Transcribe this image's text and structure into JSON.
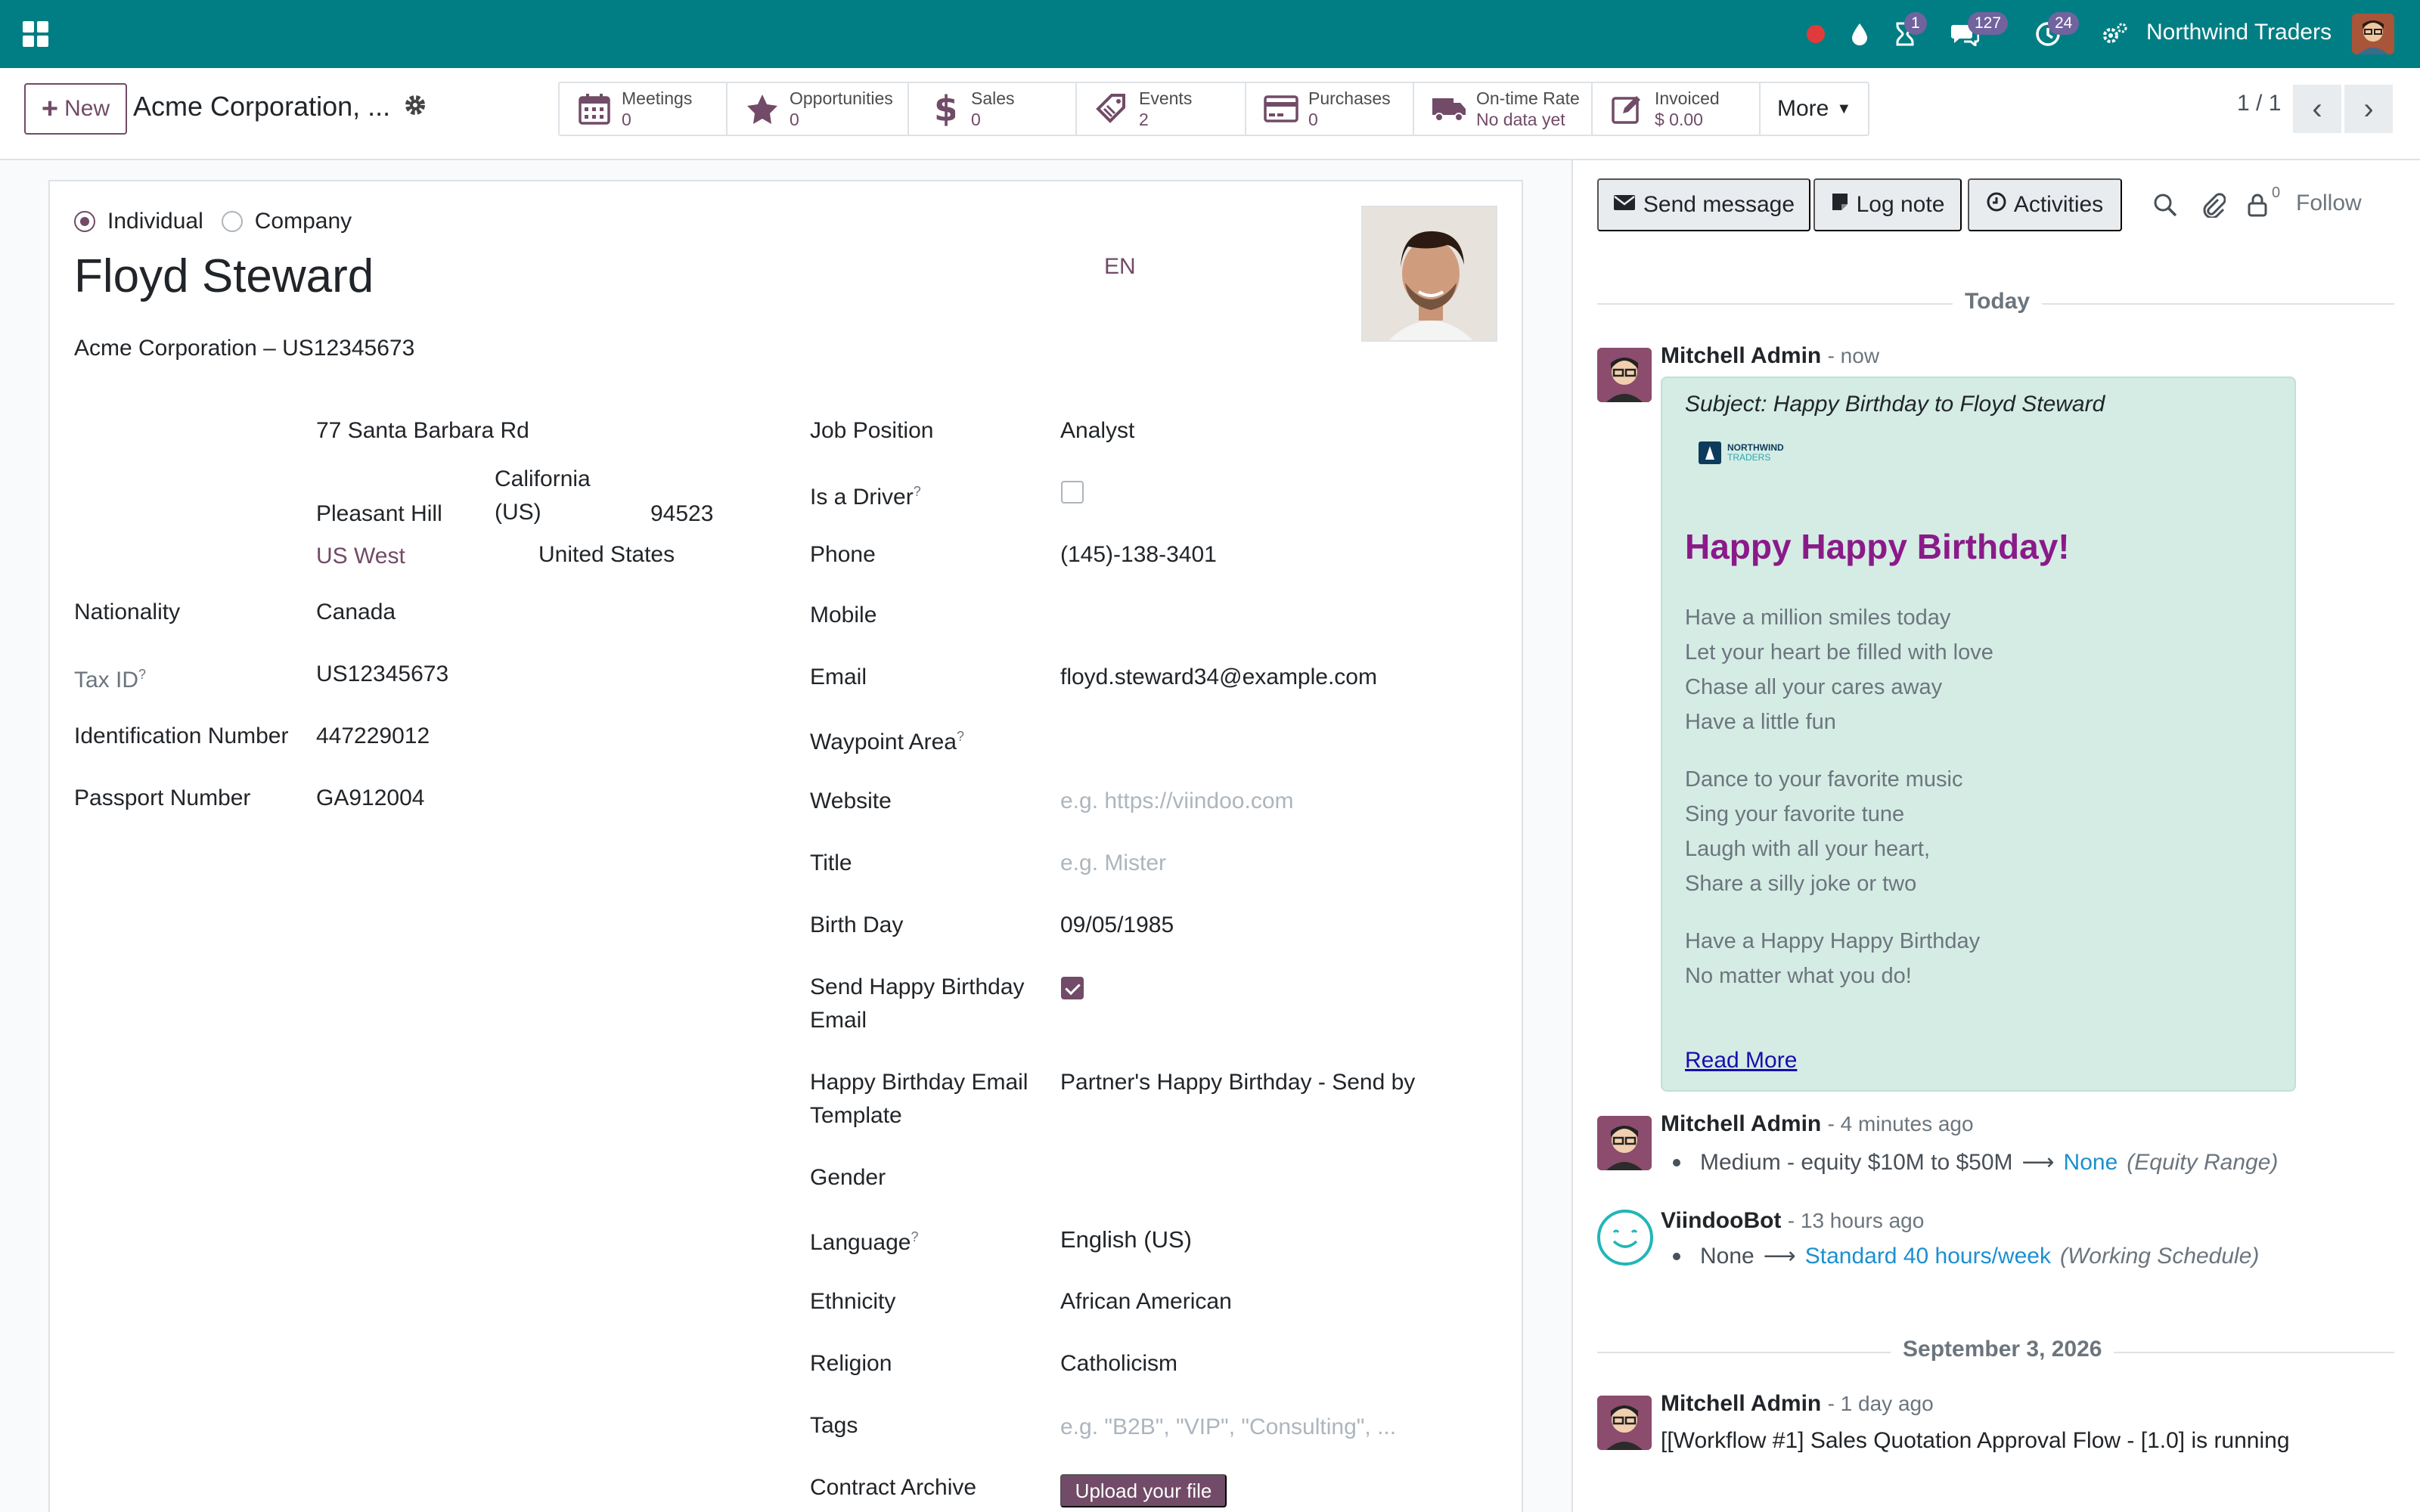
{
  "topbar": {
    "company": "Northwind Traders",
    "badges": {
      "activities": "1",
      "messages": "127",
      "clock": "24"
    }
  },
  "control_panel": {
    "new_label": "New",
    "record_title": "Acme Corporation, ...",
    "smart_buttons": [
      {
        "label": "Meetings",
        "value": "0",
        "icon": "calendar-icon"
      },
      {
        "label": "Opportunities",
        "value": "0",
        "icon": "star-icon"
      },
      {
        "label": "Sales",
        "value": "0",
        "icon": "dollar-icon"
      },
      {
        "label": "Events",
        "value": "2",
        "icon": "ticket-icon"
      },
      {
        "label": "Purchases",
        "value": "0",
        "icon": "credit-card-icon"
      },
      {
        "label": "On-time Rate",
        "value": "No data yet",
        "icon": "truck-icon"
      },
      {
        "label": "Invoiced",
        "value": "$ 0.00",
        "icon": "edit-icon"
      }
    ],
    "more_label": "More",
    "pager": "1 / 1"
  },
  "form": {
    "type_individual": "Individual",
    "type_company": "Company",
    "name": "Floyd Steward",
    "lang_code": "EN",
    "parent": "Acme Corporation – US12345673",
    "address": {
      "street": "77 Santa Barbara Rd",
      "city": "Pleasant Hill",
      "state": "California (US)",
      "state_line1": "California",
      "state_line2": "(US)",
      "zip": "94523",
      "region": "US West",
      "country": "United States"
    },
    "left_fields": [
      {
        "label": "Nationality",
        "value": "Canada"
      },
      {
        "label": "Tax ID",
        "value": "US12345673"
      },
      {
        "label": "Identification Number",
        "value": "447229012"
      },
      {
        "label": "Passport Number",
        "value": "GA912004"
      }
    ],
    "right": {
      "job_position_label": "Job Position",
      "job_position": "Analyst",
      "is_driver_label": "Is a Driver",
      "phone_label": "Phone",
      "phone": "(145)-138-3401",
      "mobile_label": "Mobile",
      "email_label": "Email",
      "email": "floyd.steward34@example.com",
      "waypoint_label": "Waypoint Area",
      "website_label": "Website",
      "website_placeholder": "e.g. https://viindoo.com",
      "title_label": "Title",
      "title_placeholder": "e.g. Mister",
      "birthday_label": "Birth Day",
      "birthday": "09/05/1985",
      "send_bday_label_1": "Send Happy Birthday",
      "send_bday_label_2": "Email",
      "bday_template_label_1": "Happy Birthday Email",
      "bday_template_label_2": "Template",
      "bday_template": "Partner's Happy Birthday - Send by",
      "gender_label": "Gender",
      "language_label": "Language",
      "language": "English (US)",
      "ethnicity_label": "Ethnicity",
      "ethnicity": "African American",
      "religion_label": "Religion",
      "religion": "Catholicism",
      "tags_label": "Tags",
      "tags_placeholder": "e.g. \"B2B\", \"VIP\", \"Consulting\", ...",
      "contract_label": "Contract Archive",
      "upload_label": "Upload your file"
    },
    "help_mark": "?"
  },
  "chatter": {
    "send_message": "Send message",
    "log_note": "Log note",
    "activities": "Activities",
    "follower_count": "0",
    "follow": "Follow",
    "today": "Today",
    "msg1": {
      "author": "Mitchell Admin",
      "when": "- now",
      "subject": "Subject: Happy Birthday to Floyd Steward",
      "logo_line1": "NORTHWIND",
      "logo_line2": "TRADERS",
      "heading": "Happy Happy Birthday!",
      "stanza1": [
        "Have a million smiles today",
        "Let your heart be filled with love",
        "Chase all your cares away",
        "Have a little fun"
      ],
      "stanza2": [
        "Dance to your favorite music",
        "Sing your favorite tune",
        "Laugh with all your heart,",
        "Share a silly joke or two"
      ],
      "stanza3": [
        "Have a Happy Happy Birthday",
        "No matter what you do!"
      ],
      "read_more": "Read More"
    },
    "msg2": {
      "author": "Mitchell Admin",
      "when": "- 4 minutes ago",
      "old": "Medium - equity $10M to $50M",
      "new": "None",
      "field": "(Equity Range)"
    },
    "msg3": {
      "author": "ViindooBot",
      "when": "- 13 hours ago",
      "old": "None",
      "new": "Standard 40 hours/week",
      "field": "(Working Schedule)"
    },
    "date2": "September 3, 2026",
    "msg4": {
      "author": "Mitchell Admin",
      "when": "- 1 day ago",
      "body": "[[Workflow #1] Sales Quotation Approval Flow - [1.0] is running"
    }
  }
}
